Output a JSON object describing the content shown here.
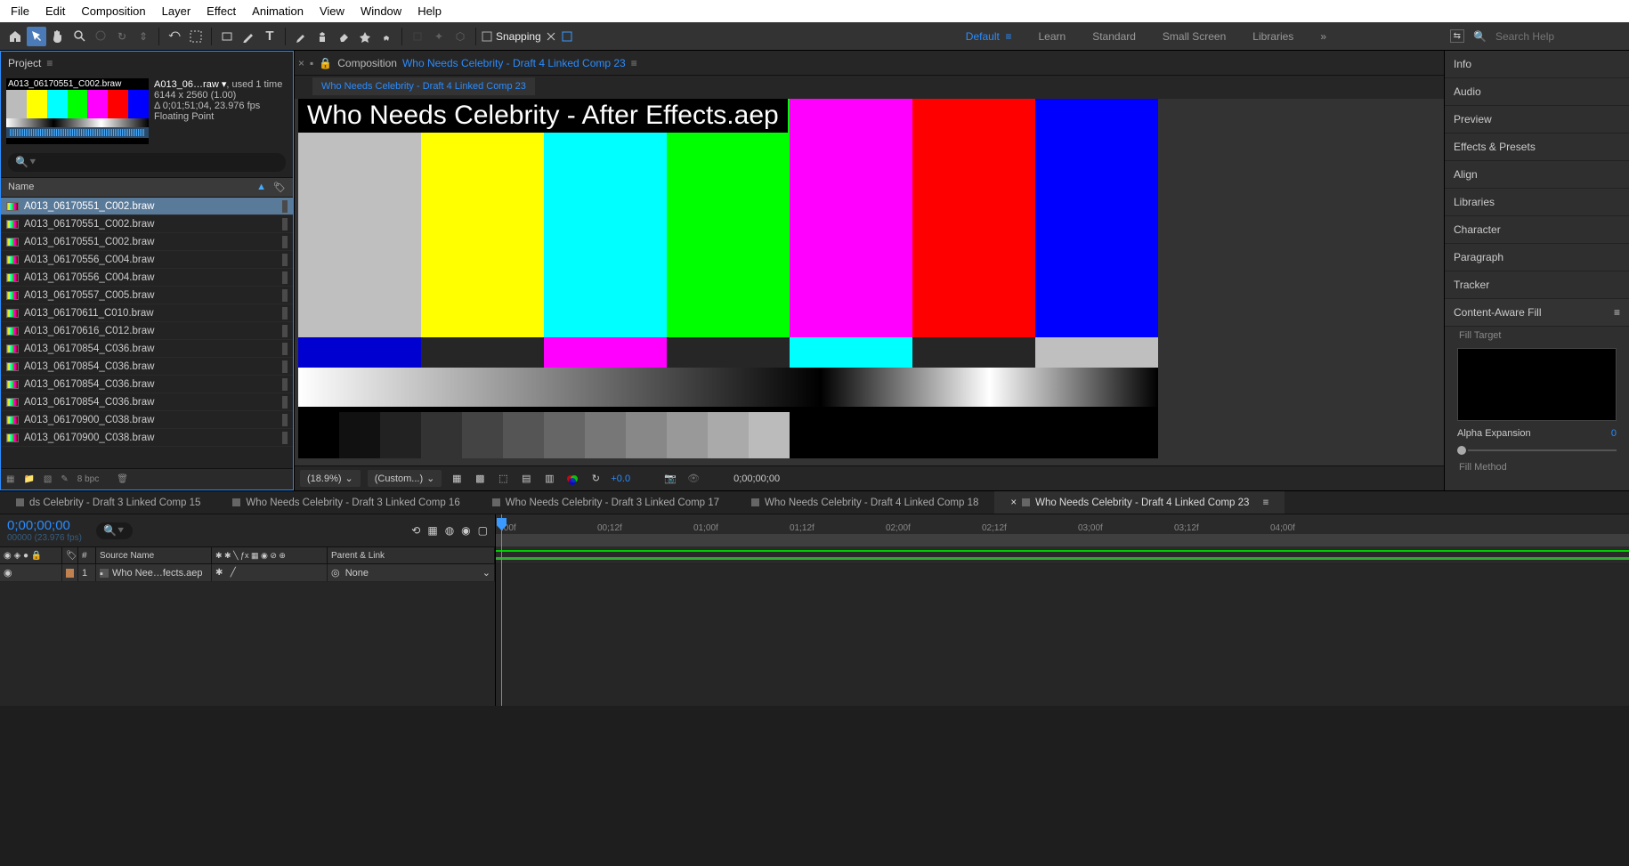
{
  "menu": [
    "File",
    "Edit",
    "Composition",
    "Layer",
    "Effect",
    "Animation",
    "View",
    "Window",
    "Help"
  ],
  "snapping": "Snapping",
  "workspaces": {
    "active": "Default",
    "items": [
      "Learn",
      "Standard",
      "Small Screen",
      "Libraries"
    ]
  },
  "search_placeholder": "Search Help",
  "project": {
    "tab": "Project",
    "asset": {
      "name": "A013_06…raw ▾",
      "used": ", used 1 time",
      "dims": "6144 x 2560 (1.00)",
      "dur": "Δ 0;01;51;04, 23.976 fps",
      "depth": "Floating Point",
      "thumb_label": "A013_06170551_C002.braw"
    },
    "col": "Name",
    "items": [
      {
        "n": "A013_06170551_C002.braw",
        "sel": true
      },
      {
        "n": "A013_06170551_C002.braw"
      },
      {
        "n": "A013_06170551_C002.braw"
      },
      {
        "n": "A013_06170556_C004.braw"
      },
      {
        "n": "A013_06170556_C004.braw"
      },
      {
        "n": "A013_06170557_C005.braw"
      },
      {
        "n": "A013_06170611_C010.braw"
      },
      {
        "n": "A013_06170616_C012.braw"
      },
      {
        "n": "A013_06170854_C036.braw"
      },
      {
        "n": "A013_06170854_C036.braw"
      },
      {
        "n": "A013_06170854_C036.braw"
      },
      {
        "n": "A013_06170854_C036.braw"
      },
      {
        "n": "A013_06170900_C038.braw"
      },
      {
        "n": "A013_06170900_C038.braw"
      }
    ],
    "bpc": "8 bpc"
  },
  "comp": {
    "pre": "Composition",
    "name": "Who Needs Celebrity - Draft 4 Linked Comp 23",
    "flow": "Who Needs Celebrity - Draft 4 Linked Comp 23",
    "overlay": "Who Needs Celebrity - After Effects.aep",
    "zoom": "(18.9%)",
    "res": "(Custom...)",
    "offset": "+0.0",
    "time": "0;00;00;00"
  },
  "right": {
    "panels": [
      "Info",
      "Audio",
      "Preview",
      "Effects & Presets",
      "Align",
      "Libraries",
      "Character",
      "Paragraph",
      "Tracker"
    ],
    "caf": "Content-Aware Fill",
    "ft": "Fill Target",
    "ae": "Alpha Expansion",
    "ae_v": "0",
    "fm": "Fill Method"
  },
  "tltabs": [
    {
      "l": "ds Celebrity - Draft 3 Linked Comp 15"
    },
    {
      "l": "Who Needs Celebrity - Draft 3 Linked Comp 16"
    },
    {
      "l": "Who Needs Celebrity - Draft 3 Linked Comp 17"
    },
    {
      "l": "Who Needs Celebrity - Draft 4 Linked Comp 18"
    },
    {
      "l": "Who Needs Celebrity - Draft 4 Linked Comp 23",
      "active": true
    }
  ],
  "tl": {
    "time": "0;00;00;00",
    "fps": "00000 (23.976 fps)",
    "cols": {
      "num": "#",
      "src": "Source Name",
      "modes": "",
      "parent": "Parent & Link"
    },
    "layer": {
      "num": "1",
      "name": "Who Nee…fects.aep",
      "parent": "None"
    },
    "ticks": [
      ":00f",
      "00;12f",
      "01;00f",
      "01;12f",
      "02;00f",
      "02;12f",
      "03;00f",
      "03;12f",
      "04;00f"
    ]
  }
}
